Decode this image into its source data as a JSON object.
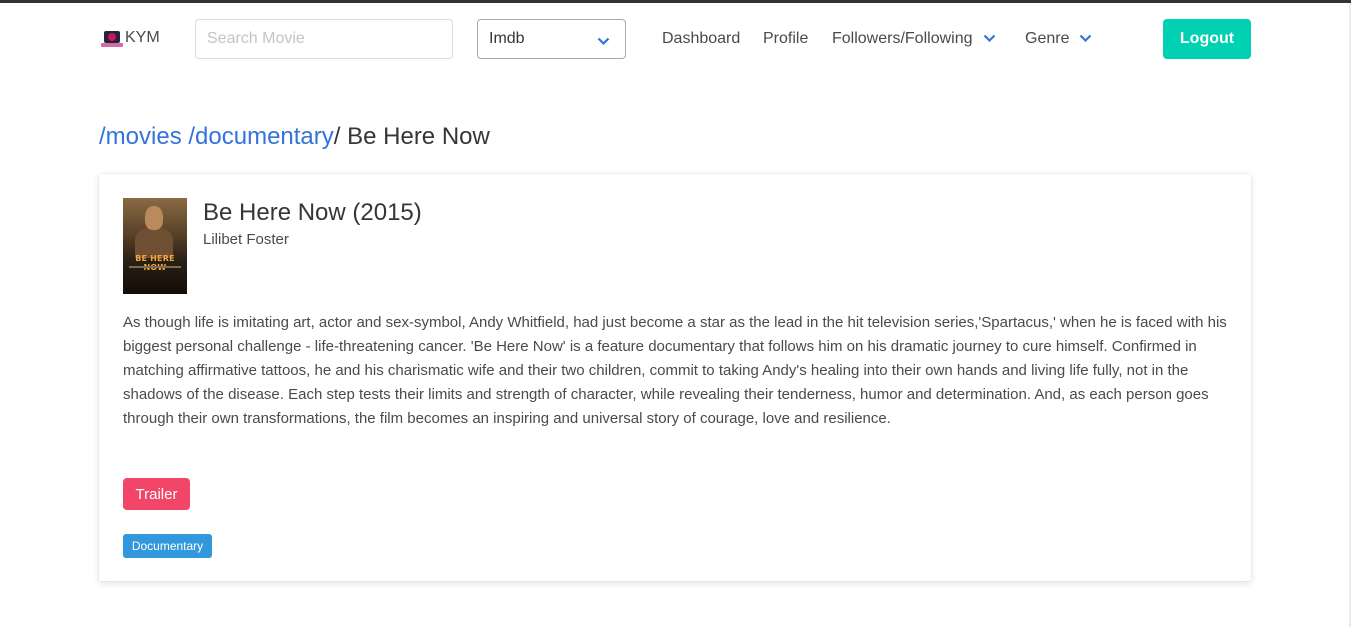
{
  "brand": {
    "name": "KYM",
    "logo_icon": "camera-logo-icon"
  },
  "search": {
    "placeholder": "Search Movie",
    "value": ""
  },
  "source_select": {
    "selected": "Imdb",
    "icon": "chevron-down-icon"
  },
  "nav": {
    "dashboard": "Dashboard",
    "profile": "Profile",
    "followers": "Followers/Following",
    "genre": "Genre",
    "logout": "Logout"
  },
  "breadcrumb": {
    "movies": "/movies",
    "category": "/documentary",
    "separator": "/",
    "current": "Be Here Now"
  },
  "movie": {
    "title": "Be Here Now (2015)",
    "director": "Lilibet Foster",
    "poster_text": "BE HERE NOW",
    "description": "As though life is imitating art, actor and sex-symbol, Andy Whitfield, had just become a star as the lead in the hit television series,'Spartacus,' when he is faced with his biggest personal challenge - life-threatening cancer. 'Be Here Now' is a feature documentary that follows him on his dramatic journey to cure himself. Confirmed in matching affirmative tattoos, he and his charismatic wife and their two children, commit to taking Andy's healing into their own hands and living life fully, not in the shadows of the disease. Each step tests their limits and strength of character, while revealing their tenderness, humor and determination. And, as each person goes through their own transformations, the film becomes an inspiring and universal story of courage, love and resilience.",
    "trailer_label": "Trailer",
    "genre_tag": "Documentary"
  },
  "colors": {
    "link": "#3273dc",
    "logout": "#00d1b2",
    "trailer": "#f14668",
    "tag": "#3298dc"
  }
}
